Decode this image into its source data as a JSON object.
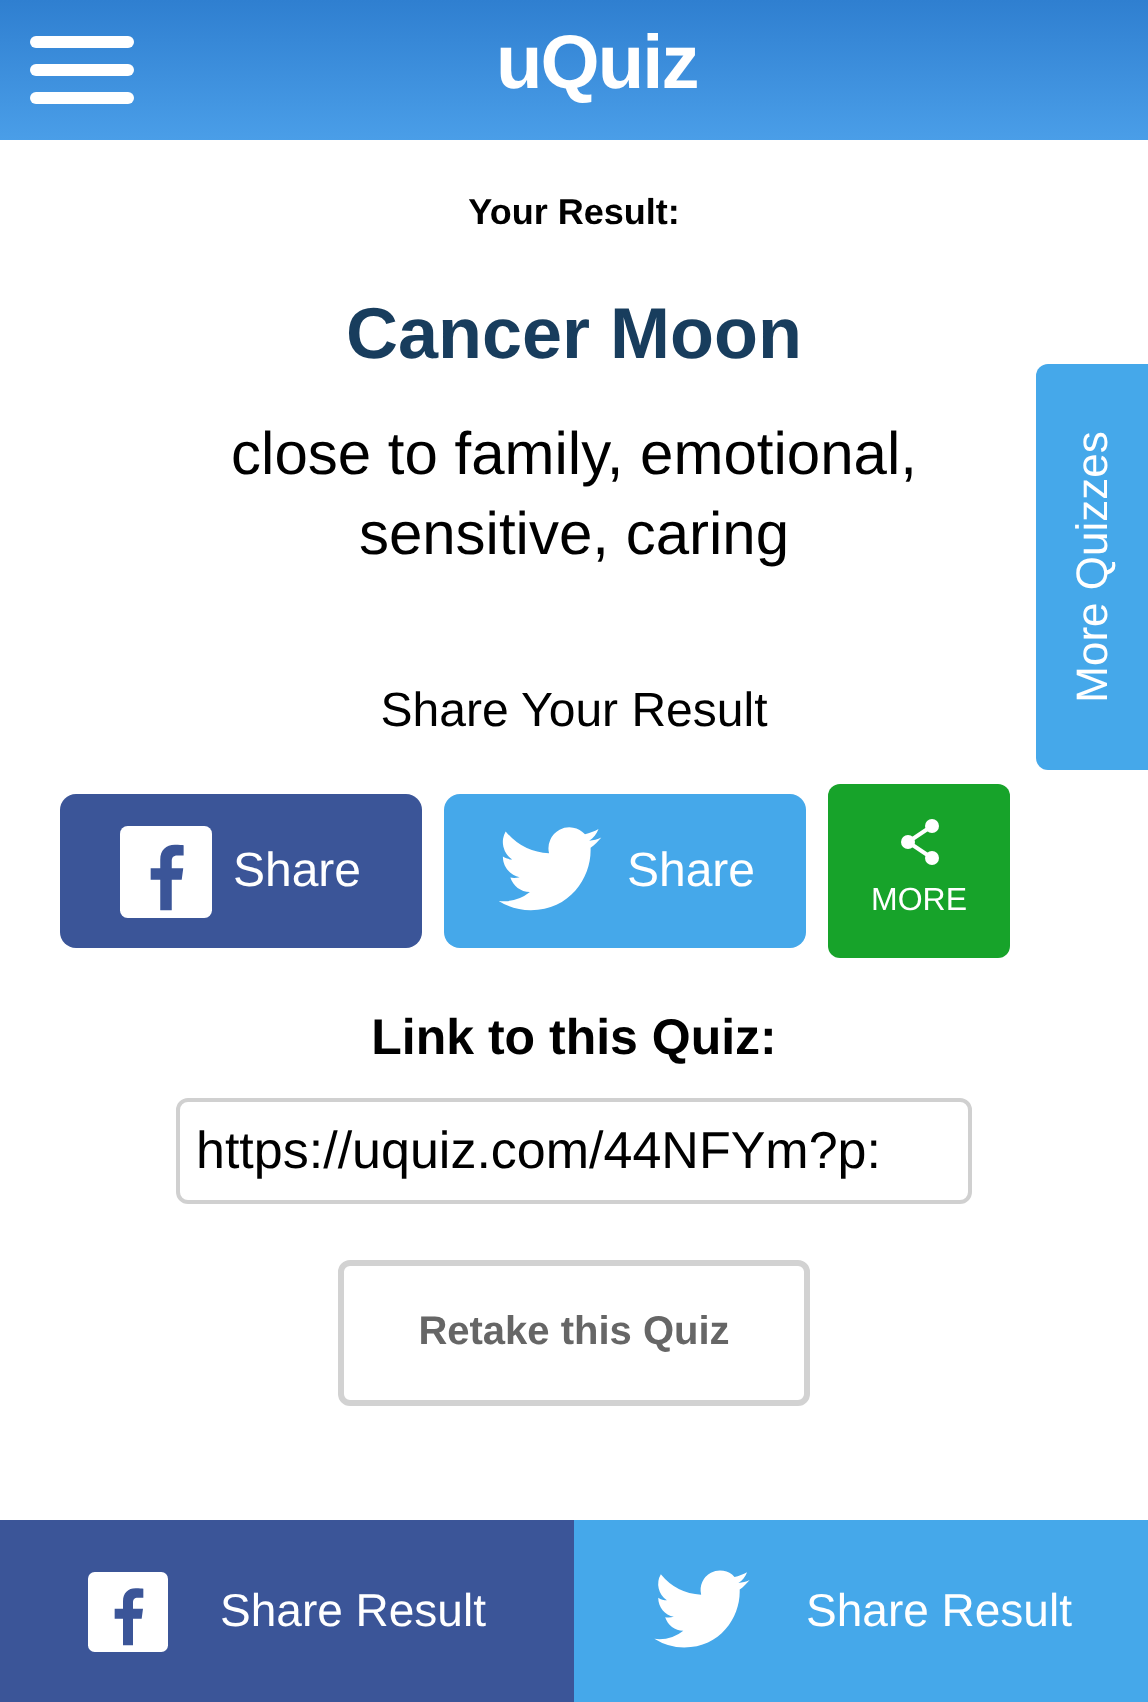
{
  "header": {
    "logo": "uQuiz"
  },
  "result": {
    "heading": "Your Result:",
    "title": "Cancer Moon",
    "description": "close to family, emotional, sensitive, caring"
  },
  "share": {
    "heading": "Share Your Result",
    "buttons": [
      {
        "kind": "facebook",
        "label": "Share"
      },
      {
        "kind": "twitter",
        "label": "Share"
      },
      {
        "kind": "more",
        "label": "MORE"
      }
    ]
  },
  "link": {
    "heading": "Link to this Quiz:",
    "value": "https://uquiz.com/44NFYm?p:"
  },
  "retake_button": "Retake this Quiz",
  "side_tab": "More Quizzes",
  "bottom_bar": [
    {
      "kind": "facebook",
      "label": "Share Result"
    },
    {
      "kind": "twitter",
      "label": "Share Result"
    }
  ]
}
